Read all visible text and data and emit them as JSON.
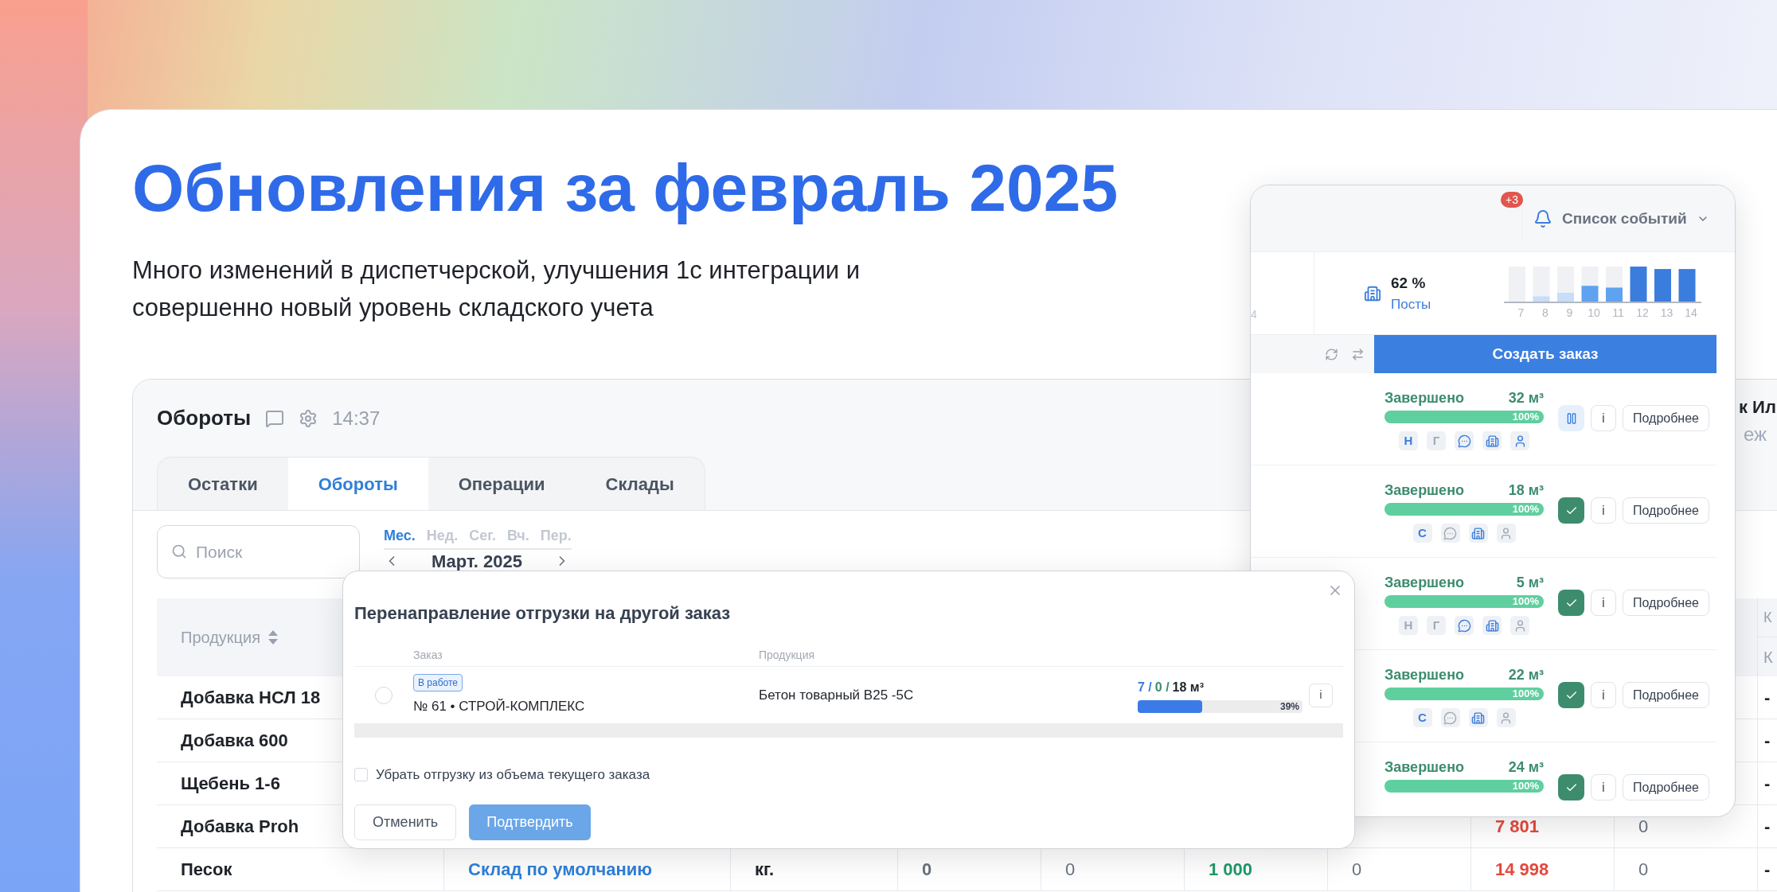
{
  "banner": {
    "title": "Обновления за февраль 2025",
    "subtitle_lines": [
      "Много изменений в диспетчерской, улучшения 1с интеграции и",
      "совершенно новый уровень складского учета"
    ]
  },
  "stock_window": {
    "title": "Обороты",
    "time": "14:37",
    "corner_texts": [
      "к Ил",
      "еж"
    ],
    "tabs": [
      {
        "label": "Остатки",
        "selected": false
      },
      {
        "label": "Обороты",
        "selected": true
      },
      {
        "label": "Операции",
        "selected": false
      },
      {
        "label": "Склады",
        "selected": false
      }
    ],
    "search": {
      "placeholder": "Поиск"
    },
    "periods": [
      {
        "label": "Мес.",
        "selected": true
      },
      {
        "label": "Нед.",
        "selected": false
      },
      {
        "label": "Сег.",
        "selected": false
      },
      {
        "label": "Вч.",
        "selected": false
      },
      {
        "label": "Пер.",
        "selected": false
      }
    ],
    "month": "Март. 2025",
    "table": {
      "columns": [
        {
          "label": "Продукция",
          "sortable": true
        },
        {},
        {},
        {},
        {},
        {},
        {},
        {},
        {},
        {
          "label": "К",
          "sub_label": "К"
        }
      ],
      "rows": [
        {
          "cells": [
            "Добавка НСЛ 18",
            null,
            null,
            null,
            null,
            null,
            null,
            null,
            null,
            "-"
          ]
        },
        {
          "cells": [
            "Добавка 600",
            null,
            null,
            null,
            null,
            null,
            null,
            null,
            null,
            "-"
          ]
        },
        {
          "cells": [
            "Щебень 1-6",
            null,
            null,
            null,
            null,
            null,
            null,
            null,
            null,
            "-"
          ]
        },
        {
          "cells": [
            "Добавка Proh",
            null,
            null,
            null,
            null,
            null,
            null,
            "7 801",
            "0",
            "-"
          ]
        },
        {
          "cells": [
            "Песок",
            "Склад по умолчанию",
            "кг.",
            "0",
            "0",
            "1 000",
            "0",
            "14 998",
            "0",
            "-"
          ]
        }
      ]
    }
  },
  "redirect_dialog": {
    "title": "Перенаправление отгрузки на другой заказ",
    "columns": [
      "Заказ",
      "Продукция"
    ],
    "orders": [
      {
        "selected": false,
        "status": "В работе",
        "name": "№ 61 • СТРОЙ-КОМПЛЕКС",
        "product": "Бетон товарный В25 -5С",
        "planned": "7 /",
        "loaded": "0 /",
        "total": "18 м³",
        "level": 0.39,
        "percent": "39%",
        "info": "i"
      }
    ],
    "remove_option": {
      "label": "Убрать отгрузку из объема текущего заказа",
      "checked": false
    },
    "buttons": [
      {
        "label": "Отменить",
        "kind": "secondary"
      },
      {
        "label": "Подтвердить",
        "kind": "primary"
      }
    ]
  },
  "events_panel": {
    "events_button": {
      "label": "Список событий",
      "badge": "+3"
    },
    "axis_tick": "4",
    "stat": {
      "value": "62 %",
      "label": "Посты"
    },
    "hour_labels": [
      "7",
      "8",
      "9",
      "10",
      "11",
      "12",
      "13",
      "14"
    ],
    "create_button": "Создать заказ",
    "orders": [
      {
        "status": "Завершено",
        "volume": "32 м³",
        "level": 1,
        "percent": "100%",
        "done": false,
        "info": "i",
        "details": "Подробнее",
        "tags": [
          {
            "kind": "letter",
            "text": "Н",
            "active": true
          },
          {
            "kind": "letter",
            "text": "Г",
            "active": false
          },
          {
            "kind": "chat",
            "active": true
          },
          {
            "kind": "building",
            "active": true
          },
          {
            "kind": "person",
            "active": true
          }
        ]
      },
      {
        "status": "Завершено",
        "volume": "18 м³",
        "level": 1,
        "percent": "100%",
        "done": true,
        "info": "i",
        "details": "Подробнее",
        "tags": [
          {
            "kind": "letter",
            "text": "С",
            "active": true
          },
          {
            "kind": "chat",
            "active": false
          },
          {
            "kind": "building",
            "active": true
          },
          {
            "kind": "person",
            "active": false
          }
        ]
      },
      {
        "status": "Завершено",
        "volume": "5 м³",
        "level": 1,
        "percent": "100%",
        "done": true,
        "info": "i",
        "details": "Подробнее",
        "tags": [
          {
            "kind": "letter",
            "text": "Н",
            "active": false
          },
          {
            "kind": "letter",
            "text": "Г",
            "active": false
          },
          {
            "kind": "chat",
            "active": true
          },
          {
            "kind": "building",
            "active": true
          },
          {
            "kind": "person",
            "active": false
          }
        ]
      },
      {
        "status": "Завершено",
        "volume": "22 м³",
        "level": 1,
        "percent": "100%",
        "done": true,
        "info": "i",
        "details": "Подробнее",
        "tags": [
          {
            "kind": "letter",
            "text": "С",
            "active": true
          },
          {
            "kind": "chat",
            "active": false
          },
          {
            "kind": "building",
            "active": true
          },
          {
            "kind": "person",
            "active": false
          }
        ]
      },
      {
        "status": "Завершено",
        "volume": "24 м³",
        "level": 1,
        "percent": "100%",
        "done": true,
        "info": "i",
        "details": "Подробнее"
      }
    ]
  }
}
